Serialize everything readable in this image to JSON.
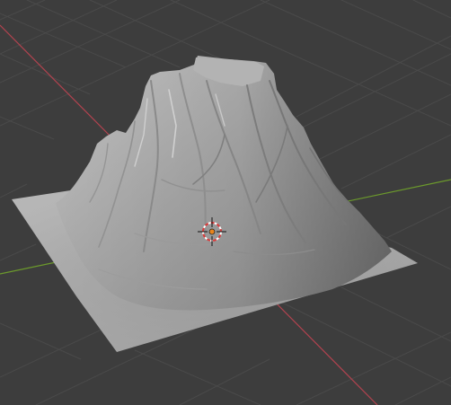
{
  "viewport": {
    "background_color": "#3d3d3d",
    "grid_color": "#4a4a4a",
    "x_axis_color": "#b2434f",
    "y_axis_color": "#6c9a2c",
    "object": "terrain-mesh",
    "object_color": "#a8a8a8",
    "shading": "solid",
    "cursor_icon": "3d-cursor-icon"
  }
}
